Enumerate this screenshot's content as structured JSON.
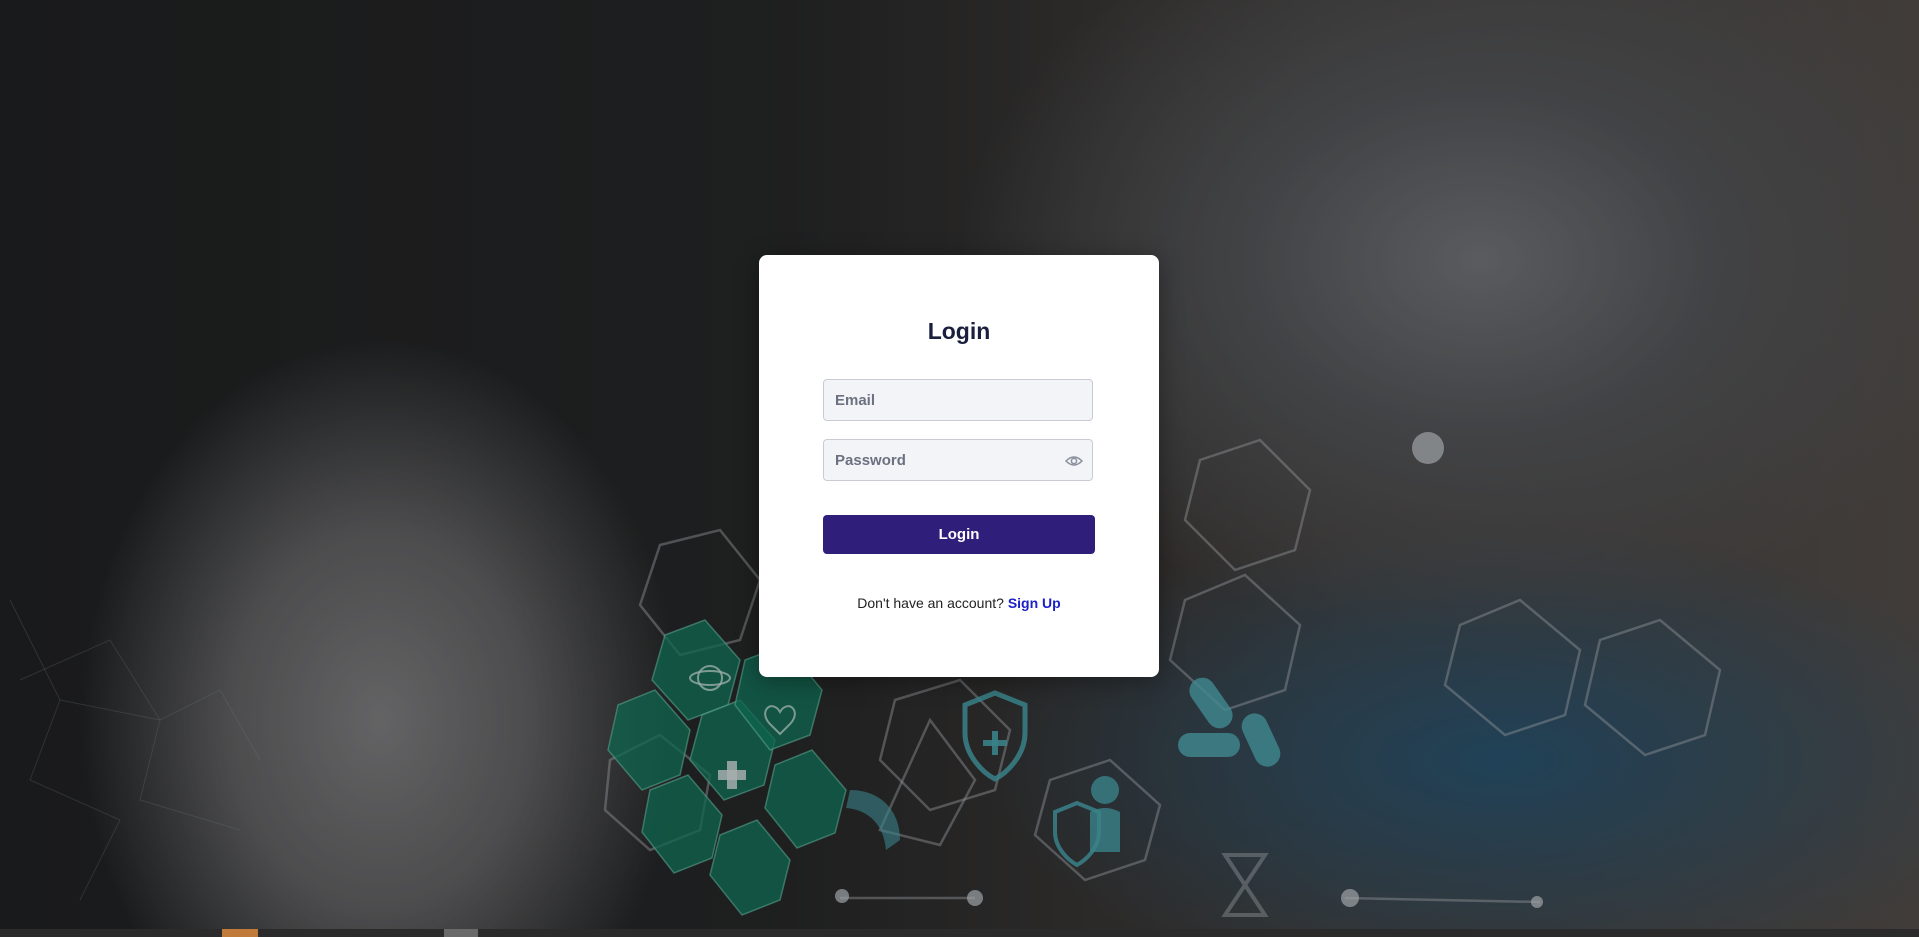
{
  "login": {
    "title": "Login",
    "email_placeholder": "Email",
    "password_placeholder": "Password",
    "password_toggle_icon": "eye-icon",
    "submit_label": "Login",
    "signup_prompt": "Don't have an account?",
    "signup_link": "Sign Up"
  },
  "colors": {
    "button": "#2f1e7a",
    "link": "#1a1fc9",
    "title": "#1a1f3d"
  }
}
